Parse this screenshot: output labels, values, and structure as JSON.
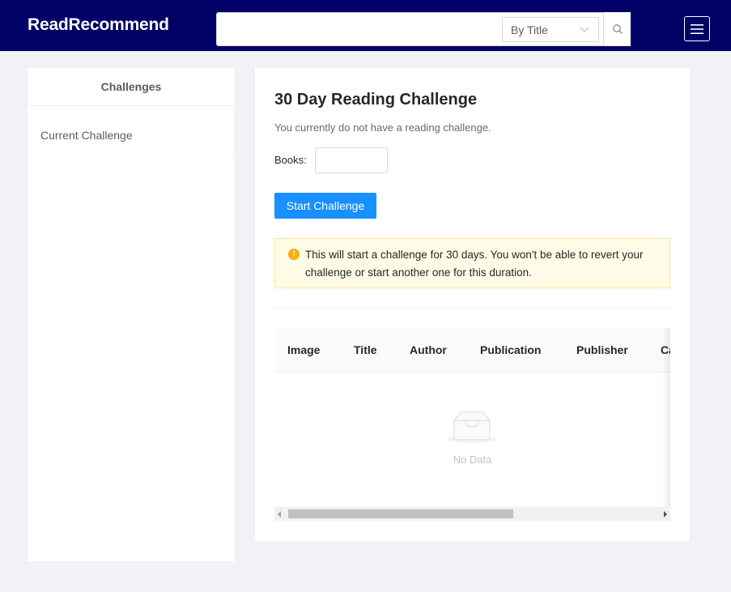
{
  "navbar": {
    "brand": "ReadRecommend",
    "search_placeholder": "",
    "search_mode": "By Title",
    "search_icon": "search-icon",
    "menu_icon": "hamburger-menu-icon",
    "background": "#000066"
  },
  "sidebar": {
    "header": "Challenges",
    "items": [
      {
        "label": "Current Challenge"
      }
    ]
  },
  "main": {
    "title": "30 Day Reading Challenge",
    "subtitle": "You currently do not have a reading challenge.",
    "books_label": "Books:",
    "books_value": "",
    "start_button": "Start Challenge",
    "alert": {
      "icon": "exclamation-circle-icon",
      "text": "This will start a challenge for 30 days. You won't be able to revert your challenge or start another one for this duration."
    },
    "table": {
      "columns": [
        "Image",
        "Title",
        "Author",
        "Publication",
        "Publisher",
        "Ca"
      ],
      "empty_text": "No Data",
      "empty_icon": "empty-inbox-icon"
    }
  },
  "colors": {
    "primary": "#1890ff",
    "warning": "#faad14",
    "alert_bg": "#fffbe6",
    "alert_border": "#ffe58f"
  }
}
